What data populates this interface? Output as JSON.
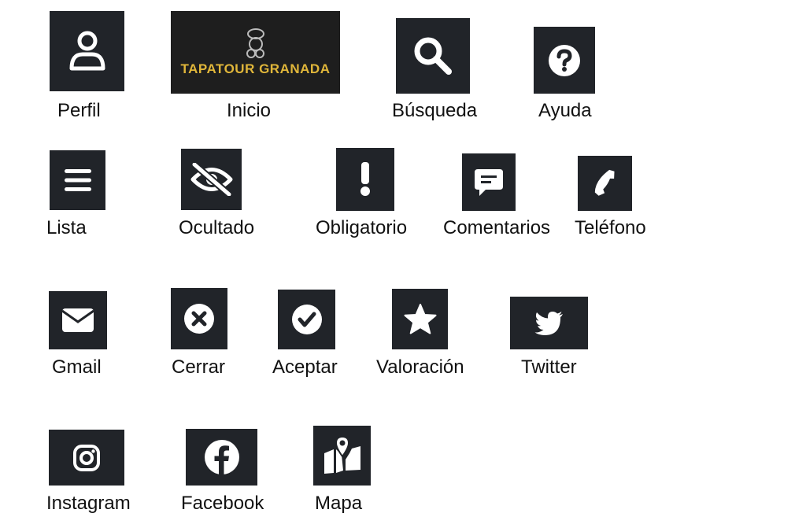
{
  "colors": {
    "tile_background": "#212429",
    "icon": "#ffffff",
    "logo_text": "#e0b63a",
    "label_text": "#111111"
  },
  "logo": {
    "text": "TAPATOUR GRANADA",
    "icon": "chef-mascot-icon"
  },
  "items": {
    "perfil": {
      "label": "Perfil",
      "icon": "user-icon"
    },
    "inicio": {
      "label": "Inicio",
      "icon": "logo"
    },
    "busqueda": {
      "label": "Búsqueda",
      "icon": "search-icon"
    },
    "ayuda": {
      "label": "Ayuda",
      "icon": "question-circle-icon"
    },
    "lista": {
      "label": "Lista",
      "icon": "menu-icon"
    },
    "ocultado": {
      "label": "Ocultado",
      "icon": "eye-slash-icon"
    },
    "obligatorio": {
      "label": "Obligatorio",
      "icon": "exclamation-icon"
    },
    "comentarios": {
      "label": "Comentarios",
      "icon": "comment-icon"
    },
    "telefono": {
      "label": "Teléfono",
      "icon": "phone-icon"
    },
    "gmail": {
      "label": "Gmail",
      "icon": "envelope-icon"
    },
    "cerrar": {
      "label": "Cerrar",
      "icon": "close-circle-icon"
    },
    "aceptar": {
      "label": "Aceptar",
      "icon": "check-circle-icon"
    },
    "valoracion": {
      "label": "Valoración",
      "icon": "star-icon"
    },
    "twitter": {
      "label": "Twitter",
      "icon": "twitter-icon"
    },
    "instagram": {
      "label": "Instagram",
      "icon": "instagram-icon"
    },
    "facebook": {
      "label": "Facebook",
      "icon": "facebook-icon"
    },
    "mapa": {
      "label": "Mapa",
      "icon": "map-icon"
    }
  }
}
